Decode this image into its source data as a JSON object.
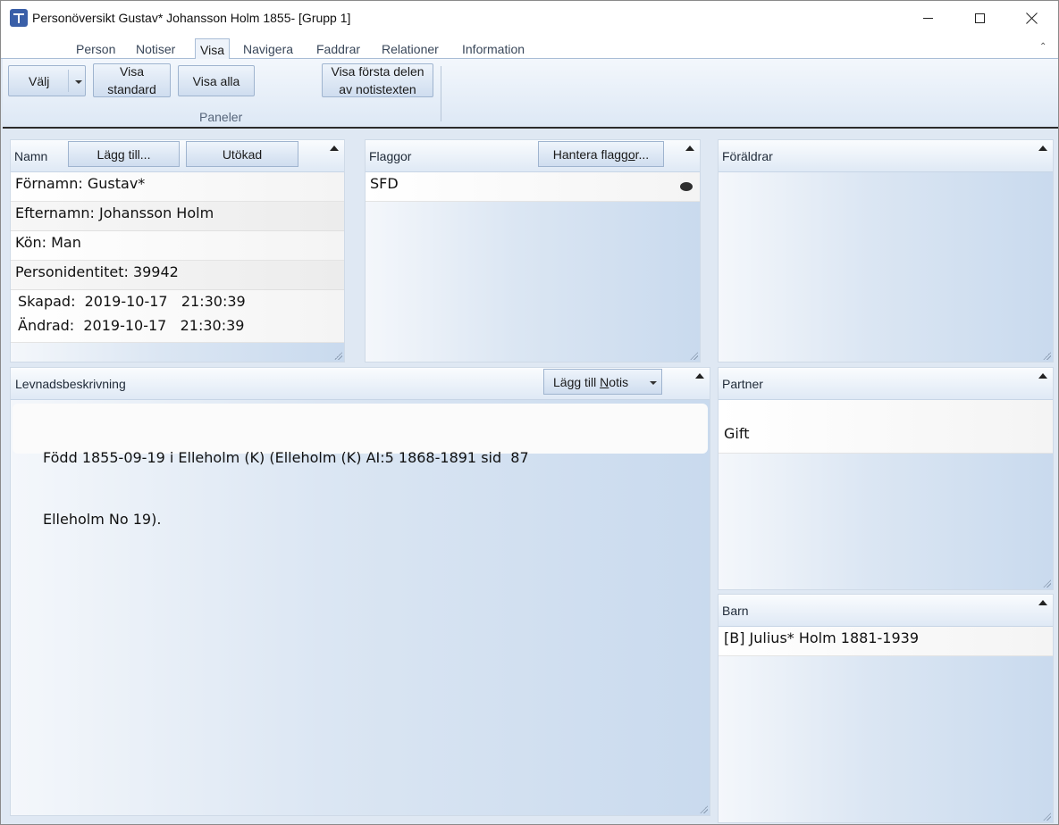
{
  "window": {
    "title": "Personöversikt Gustav* Johansson Holm 1855- [Grupp 1]"
  },
  "ribbon": {
    "tabs": [
      "Person",
      "Notiser",
      "Visa",
      "Navigera",
      "Faddrar",
      "Relationer",
      "Information"
    ],
    "active_tab": "Visa",
    "buttons": {
      "valj": "Välj",
      "visa_standard_1": "Visa",
      "visa_standard_2": "standard",
      "visa_alla": "Visa alla",
      "visa_forsta_1": "Visa första delen",
      "visa_forsta_2": "av notistexten"
    },
    "group_label": "Paneler"
  },
  "namn_panel": {
    "title": "Namn",
    "add_button": "Lägg till...",
    "extended_button": "Utökad",
    "fornamn": "Förnamn: Gustav*",
    "efternamn": "Efternamn: Johansson Holm",
    "kon": "Kön: Man",
    "personidentitet": "Personidentitet: 39942",
    "skapad_label": "Skapad:",
    "skapad_date": "2019-10-17",
    "skapad_time": "21:30:39",
    "andrad_label": "Ändrad:",
    "andrad_date": "2019-10-17",
    "andrad_time": "21:30:39"
  },
  "flaggor_panel": {
    "title": "Flaggor",
    "manage_button_prefix": "Hantera flagg",
    "manage_button_underlined": "o",
    "manage_button_suffix": "r...",
    "flags": [
      "SFD"
    ]
  },
  "foraldrar_panel": {
    "title": "Föräldrar"
  },
  "levnad_panel": {
    "title": "Levnadsbeskrivning",
    "add_button_prefix": "Lägg till ",
    "add_button_underlined": "N",
    "add_button_suffix": "otis",
    "text_line1": "Född 1855-09-19 i Elleholm (K) (Elleholm (K) AI:5 1868-1891 sid  87",
    "text_line2": "Elleholm No 19)."
  },
  "partner_panel": {
    "title": "Partner",
    "status": "Gift"
  },
  "barn_panel": {
    "title": "Barn",
    "children": [
      "[B] Julius*  Holm 1881-1939"
    ]
  }
}
